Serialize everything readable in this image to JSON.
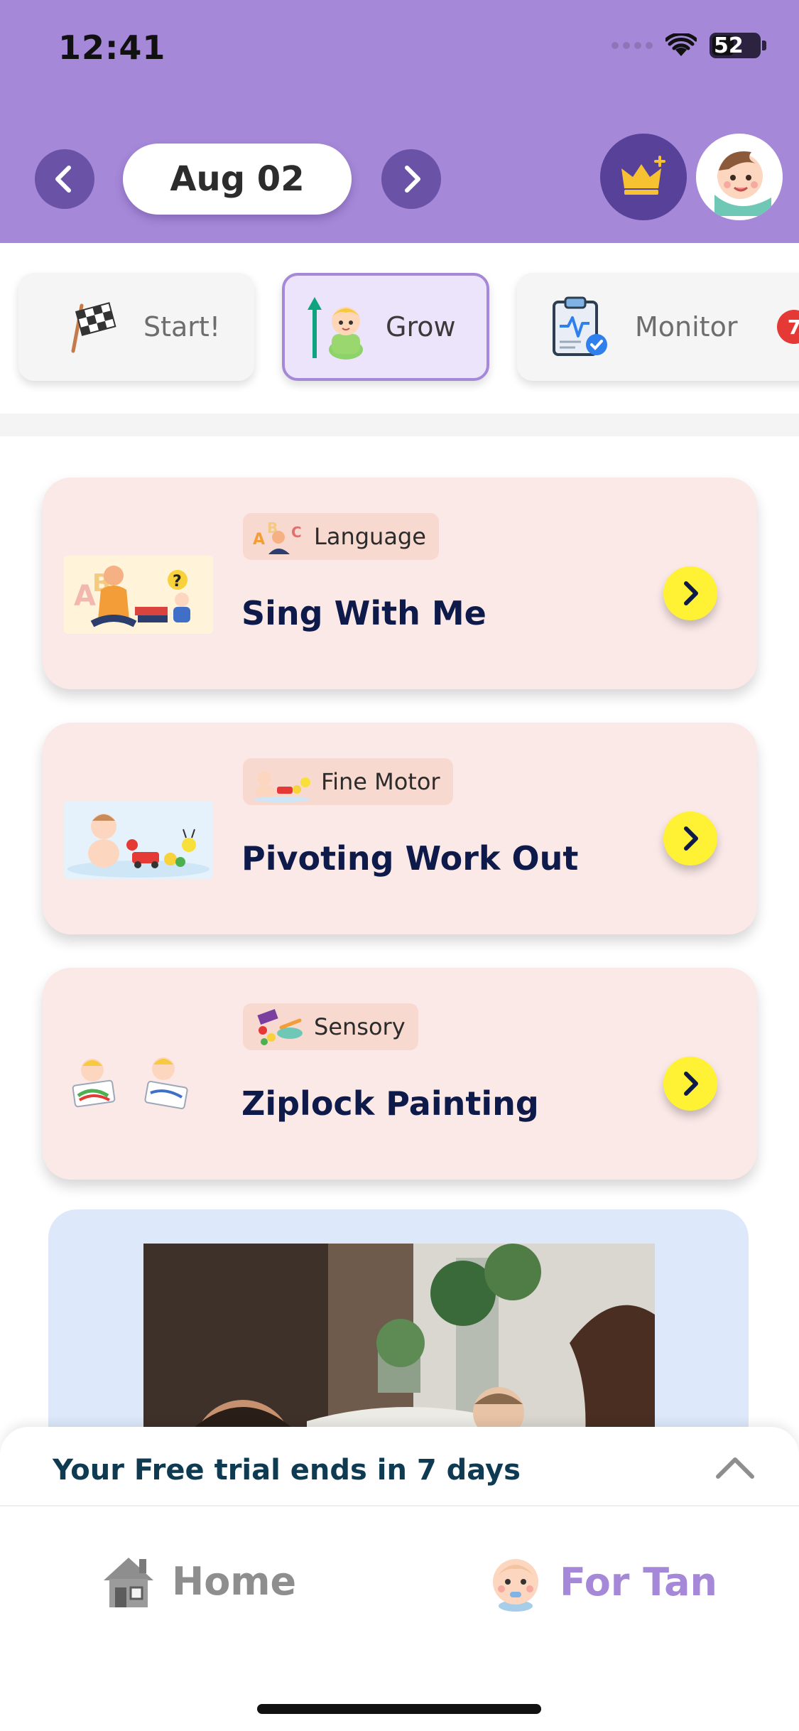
{
  "status_bar": {
    "time": "12:41",
    "battery": "52"
  },
  "header": {
    "date": "Aug 02",
    "prev_icon": "chevron-left-icon",
    "next_icon": "chevron-right-icon",
    "premium_icon": "crown-plus-icon",
    "avatar_icon": "baby-avatar-icon",
    "colors": {
      "header_bg": "#a688d8",
      "nav_btn": "#6a53a6",
      "crown_btn": "#574199",
      "crown": "#f6c232"
    }
  },
  "tabs": [
    {
      "label": "Start!",
      "icon": "checkered-flag-icon",
      "active": false
    },
    {
      "label": "Grow",
      "icon": "growth-baby-icon",
      "active": true
    },
    {
      "label": "Monitor",
      "icon": "clipboard-check-icon",
      "active": false,
      "badge": "7"
    }
  ],
  "activities": [
    {
      "category": "Language",
      "title": "Sing With Me",
      "icon": "abc-letters-icon"
    },
    {
      "category": "Fine Motor",
      "title": "Pivoting Work Out",
      "icon": "baby-toys-icon"
    },
    {
      "category": "Sensory",
      "title": "Ziplock Painting",
      "icon": "paint-supplies-icon"
    }
  ],
  "promo": {
    "image": "family-photo-icon"
  },
  "trial_banner": {
    "text": "Your Free trial ends in 7 days",
    "toggle_icon": "chevron-up-icon"
  },
  "bottom_nav": {
    "home_label": "Home",
    "home_icon": "house-icon",
    "child_label": "For Tan",
    "child_icon": "baby-face-icon",
    "colors": {
      "active": "#a688d8",
      "inactive": "#8e8e8e"
    }
  }
}
